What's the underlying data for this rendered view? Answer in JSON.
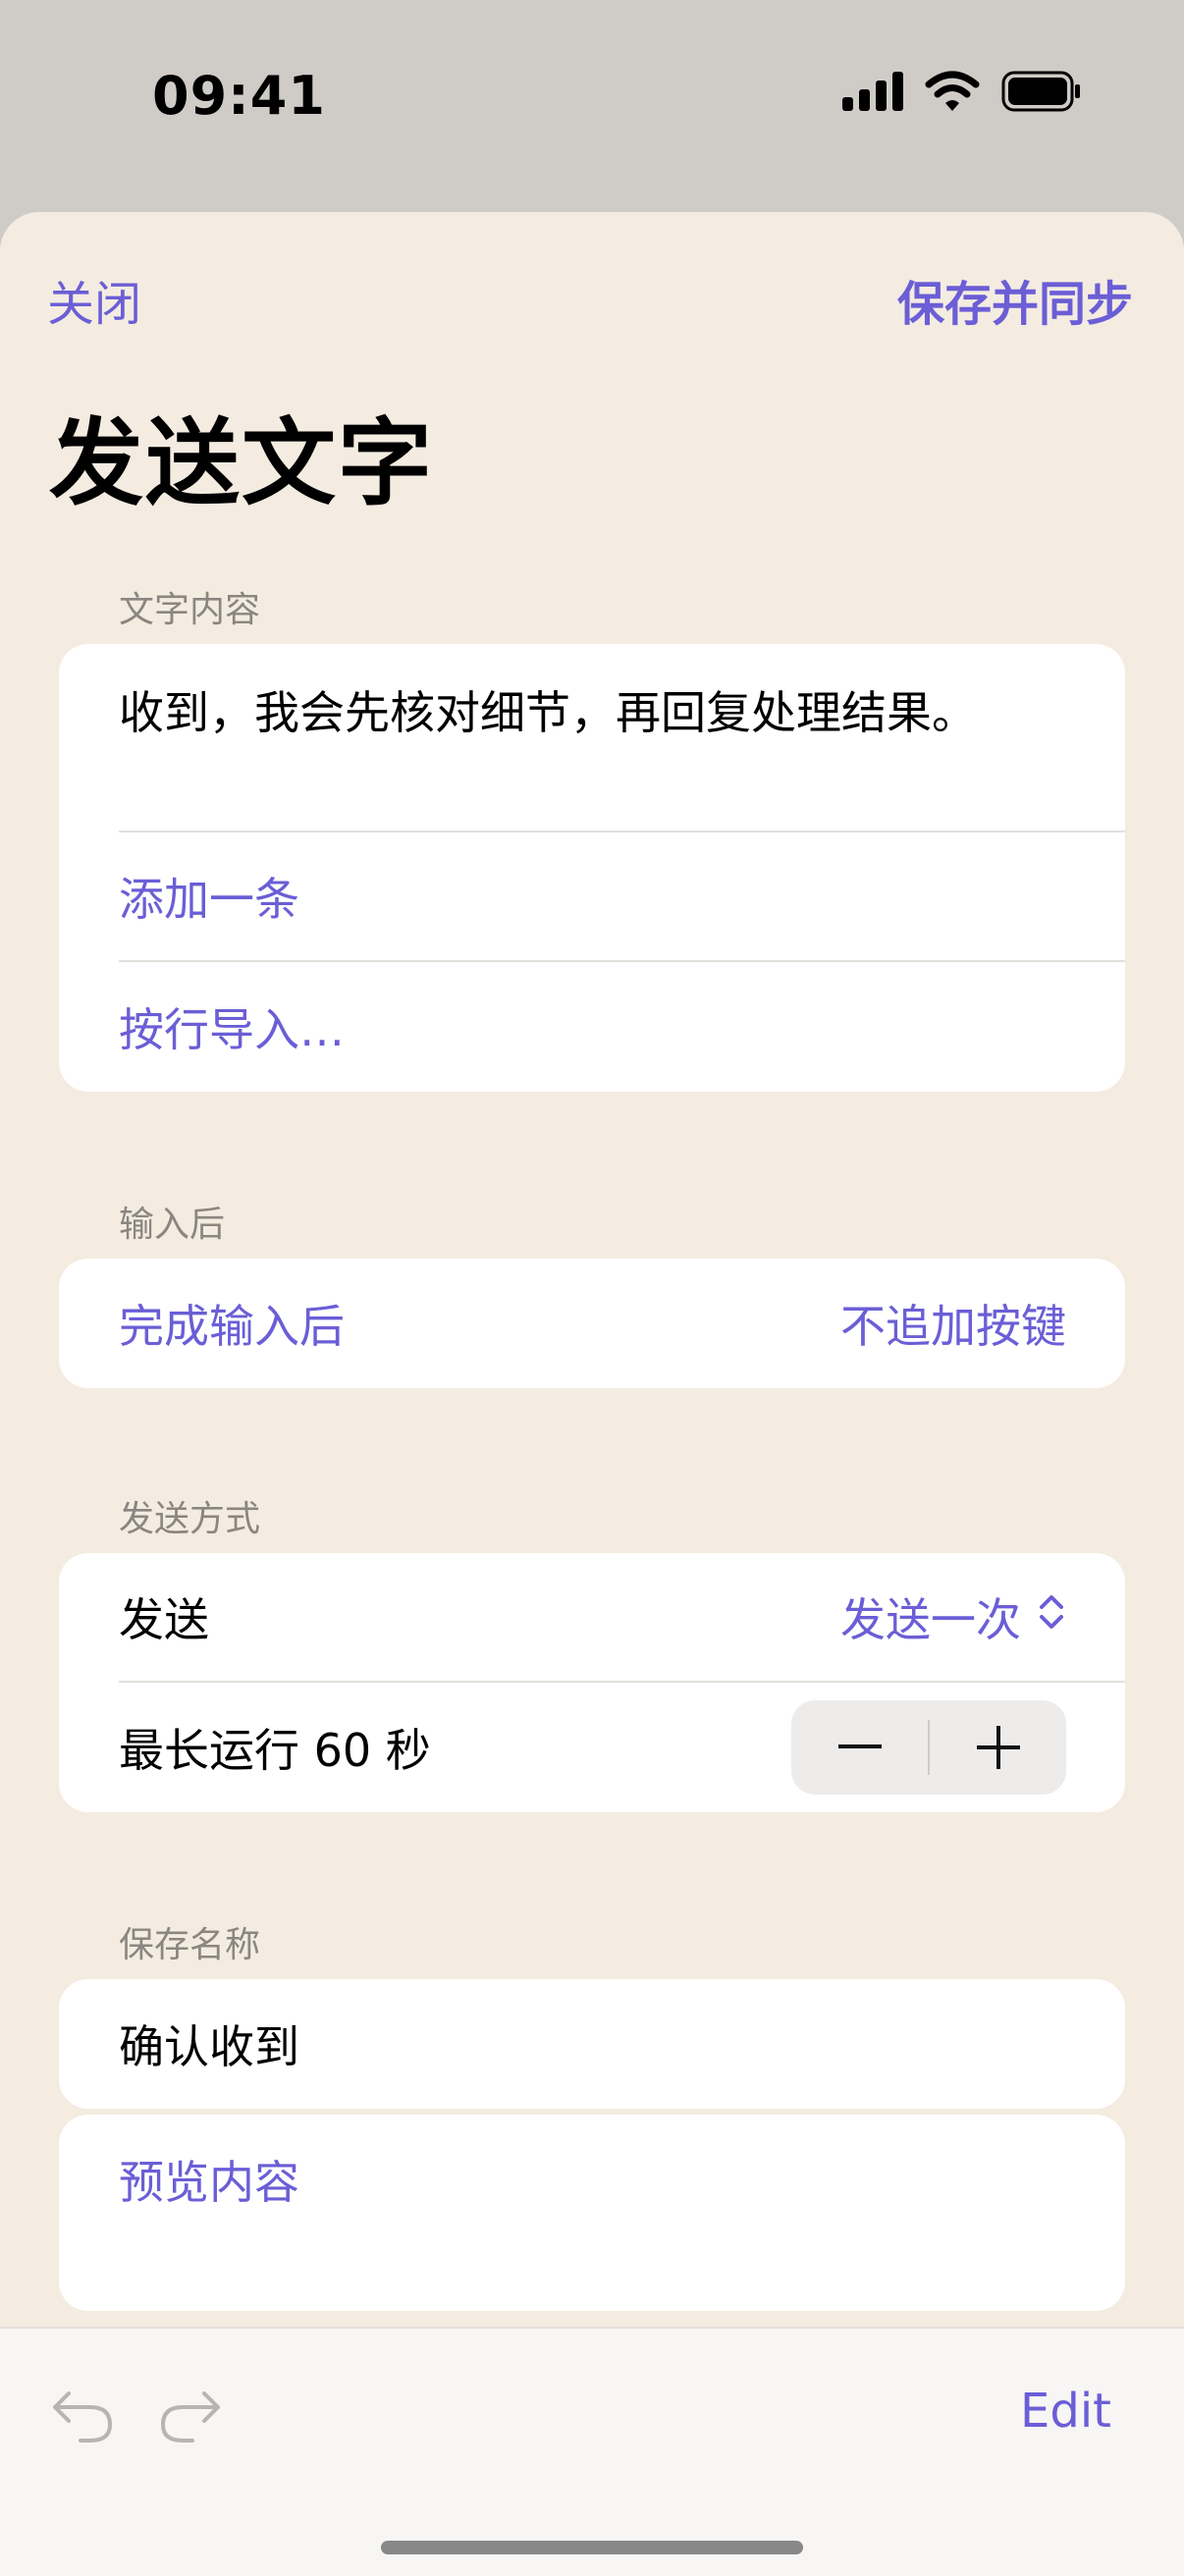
{
  "status_bar": {
    "time": "09:41"
  },
  "nav": {
    "close": "关闭",
    "save_sync": "保存并同步"
  },
  "title": "发送文字",
  "text_section": {
    "header": "文字内容",
    "content": "收到，我会先核对细节，再回复处理结果。",
    "add_item": "添加一条",
    "import_lines": "按行导入…"
  },
  "after_input": {
    "header": "输入后",
    "label": "完成输入后",
    "value": "不追加按键"
  },
  "send_mode": {
    "header": "发送方式",
    "send_label": "发送",
    "send_value": "发送一次",
    "max_run_label": "最长运行 60 秒"
  },
  "save_name": {
    "header": "保存名称",
    "value": "确认收到"
  },
  "preview": {
    "label": "预览内容"
  },
  "toolbar": {
    "edit": "Edit"
  },
  "colors": {
    "accent": "#6b5ed6",
    "sheet_background": "#f4ece1",
    "card_background": "#ffffff"
  }
}
